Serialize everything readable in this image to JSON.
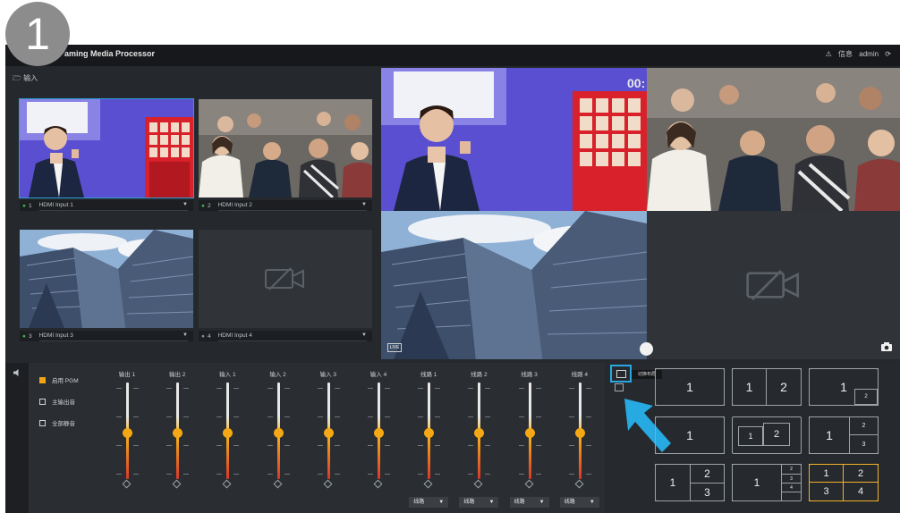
{
  "step_badge": "1",
  "app": {
    "title": "Streaming Media Processor",
    "title_visible": "aming Media Processor",
    "user": "admin",
    "status_label": "信息",
    "warning_icon": "warning-icon",
    "refresh_icon": "refresh-icon"
  },
  "sources_header": "输入",
  "sources": [
    {
      "num": "1",
      "name": "HDMI Input 1",
      "content": "presenter",
      "selected": true
    },
    {
      "num": "2",
      "name": "HDMI Input 2",
      "content": "audience",
      "selected": false
    },
    {
      "num": "3",
      "name": "HDMI Input 3",
      "content": "skyscrapers",
      "selected": false
    },
    {
      "num": "4",
      "name": "HDMI Input 4",
      "content": "no-signal",
      "selected": false
    }
  ],
  "program": {
    "timecode": "00:",
    "live_chip": "LIVE",
    "camera_icon": "camera-icon"
  },
  "options": [
    {
      "label": "启用 PGM",
      "checked": true
    },
    {
      "label": "主输出音",
      "checked": false
    },
    {
      "label": "全部静音",
      "checked": false
    }
  ],
  "mixer": {
    "channels": [
      {
        "label": "输出 1",
        "level": 0.48
      },
      {
        "label": "输出 2",
        "level": 0.48
      },
      {
        "label": "输入 1",
        "level": 0.48
      },
      {
        "label": "输入 2",
        "level": 0.48
      },
      {
        "label": "输入 3",
        "level": 0.48
      },
      {
        "label": "输入 4",
        "level": 0.48
      },
      {
        "label": "线路 1",
        "level": 0.48,
        "dropdown": "线路"
      },
      {
        "label": "线路 2",
        "level": 0.48,
        "dropdown": "线路"
      },
      {
        "label": "线路 3",
        "level": 0.48,
        "dropdown": "线路"
      },
      {
        "label": "线路 4",
        "level": 0.48,
        "dropdown": "线路"
      }
    ],
    "colors": {
      "knob": "#f5a815",
      "track_top": "#e8e8e8",
      "track_mid": "#f5b21a",
      "track_bottom": "#d9362b"
    }
  },
  "layouts": {
    "tooltip": "切换布局",
    "items": [
      {
        "name": "single",
        "labels": [
          "1"
        ]
      },
      {
        "name": "side-by-side",
        "labels": [
          "1",
          "2"
        ]
      },
      {
        "name": "pip-corner",
        "labels": [
          "1",
          "2"
        ]
      },
      {
        "name": "pip-left",
        "labels": [
          "1"
        ]
      },
      {
        "name": "pip-center",
        "labels": [
          "1",
          "2"
        ]
      },
      {
        "name": "three-right",
        "labels": [
          "1",
          "2",
          "3"
        ]
      },
      {
        "name": "three-stack",
        "labels": [
          "1",
          "2",
          "3"
        ]
      },
      {
        "name": "four-stack",
        "labels": [
          "1",
          "2",
          "3",
          "4"
        ]
      },
      {
        "name": "quad",
        "labels": [
          "1",
          "2",
          "3",
          "4"
        ],
        "selected": true
      }
    ],
    "accent": "#f1b32b",
    "highlight": "#2aa7e0"
  }
}
